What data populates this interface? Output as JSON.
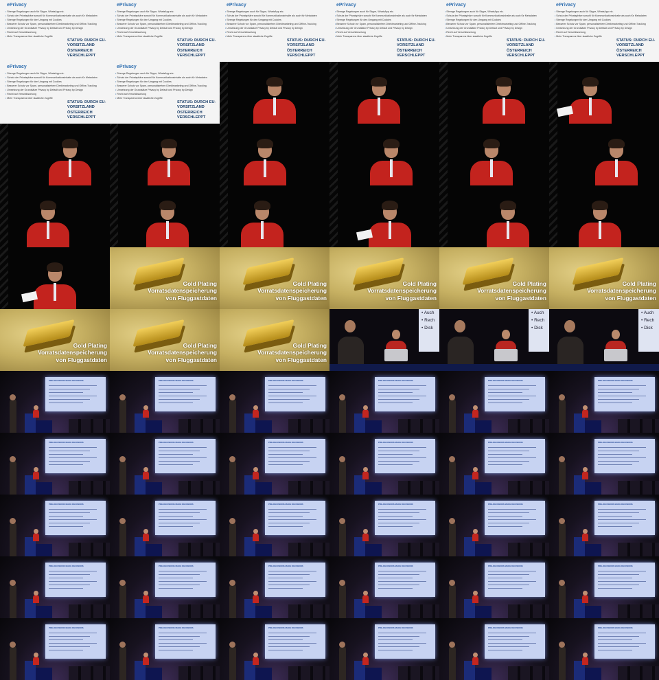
{
  "slide_eprivacy": {
    "title": "ePrivacy",
    "bullets": [
      "Strenge Regelungen auch für Skype, WhatsApp etc.",
      "Schutz der Privatsphäre sowohl für Kommunikationsinhalte als auch für Metadaten",
      "Strenge Regelungen für den Umgang mit Cookies",
      "Besserer Schutz vor Spam, personalisiertem Direktmarketing und Offline-Tracking",
      "Umsetzung der Grundsätze Privacy by Default und Privacy by Design",
      "Recht auf Verschlüsselung",
      "Mehr Transparenz über staatliche Zugriffe"
    ],
    "status_lines": [
      "STATUS: DURCH EU-",
      "VORSITZLAND ÖSTERREICH",
      "VERSCHLEPPT"
    ]
  },
  "slide_gold": {
    "lines": [
      "Gold Plating",
      "Vorratsdatenspeicherung",
      "von Fluggastdaten"
    ]
  },
  "slide_panel": {
    "screen_words": [
      "Auch",
      "Rech",
      "Disk"
    ],
    "status_fragment": "STATU"
  },
  "slide_stage": {
    "screen_heading": "PRE-DECISIONS MAKE DECISIONS"
  },
  "thumbnail_sequence": [
    "eprivacy",
    "eprivacy",
    "eprivacy",
    "eprivacy",
    "eprivacy",
    "eprivacy",
    "eprivacy",
    "eprivacy",
    "speaker",
    "speaker",
    "speaker",
    "speaker",
    "speaker",
    "speaker",
    "speaker",
    "speaker",
    "speaker",
    "speaker",
    "speaker",
    "speaker",
    "speaker",
    "speaker",
    "speaker",
    "speaker",
    "speaker",
    "gold",
    "gold",
    "gold",
    "gold",
    "gold",
    "gold",
    "gold",
    "gold",
    "panel",
    "panel",
    "panel",
    "stage",
    "stage",
    "stage",
    "stage",
    "stage",
    "stage",
    "stage",
    "stage",
    "stage",
    "stage",
    "stage",
    "stage",
    "stage",
    "stage",
    "stage",
    "stage",
    "stage",
    "stage",
    "stage",
    "stage",
    "stage",
    "stage",
    "stage",
    "stage",
    "stage",
    "stage",
    "stage",
    "stage",
    "stage",
    "stage"
  ],
  "colors": {
    "slide_blue": "#2f6fb0",
    "shirt_red": "#c3231e",
    "gold": "#d9b542",
    "stage_screen": "#c7d3f2"
  }
}
